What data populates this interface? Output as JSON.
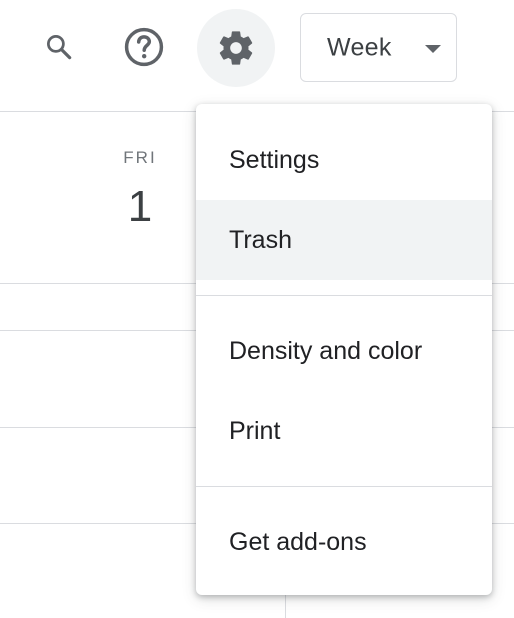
{
  "toolbar": {
    "search_icon": "search-icon",
    "help_icon": "help-icon",
    "settings_icon": "gear-icon",
    "view_select": {
      "selected": "Week",
      "caret_icon": "caret-down-icon"
    }
  },
  "calendar": {
    "day_name": "FRI",
    "day_number": "1"
  },
  "menu": {
    "groups": [
      [
        "Settings",
        "Trash"
      ],
      [
        "Density and color",
        "Print"
      ],
      [
        "Get add-ons"
      ]
    ],
    "highlighted": "Trash"
  },
  "colors": {
    "icon": "#5f6368",
    "hover_bg": "#f1f3f4",
    "border": "#dadce0",
    "text": "#202124"
  }
}
